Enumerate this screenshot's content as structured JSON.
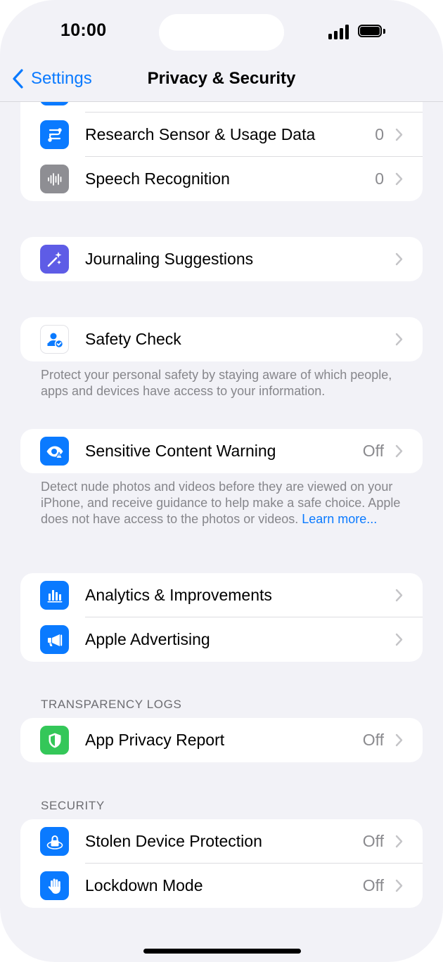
{
  "status_bar": {
    "time": "10:00"
  },
  "nav": {
    "back_label": "Settings",
    "title": "Privacy & Security"
  },
  "group_top": {
    "rows": [
      {
        "label": "Research Sensor & Usage Data",
        "value": "0",
        "icon": "research-sensor-icon",
        "color": "#0a7aff"
      },
      {
        "label": "Speech Recognition",
        "value": "0",
        "icon": "waveform-icon",
        "color": "#8e8e93"
      }
    ]
  },
  "journaling": {
    "label": "Journaling Suggestions",
    "icon": "sparkles-icon",
    "color": "#5e5ce6"
  },
  "safety_check": {
    "label": "Safety Check",
    "icon": "person-check-icon",
    "footnote": "Protect your personal safety by staying aware of which people, apps and devices have access to your information."
  },
  "sensitive": {
    "label": "Sensitive Content Warning",
    "value": "Off",
    "icon": "eye-warning-icon",
    "color": "#0a7aff",
    "footnote": "Detect nude photos and videos before they are viewed on your iPhone, and receive guidance to help make a safe choice. Apple does not have access to the photos or videos.",
    "learn_more": "Learn more..."
  },
  "analytics_group": {
    "rows": [
      {
        "label": "Analytics & Improvements",
        "icon": "bar-chart-icon",
        "color": "#0a7aff"
      },
      {
        "label": "Apple Advertising",
        "icon": "megaphone-icon",
        "color": "#0a7aff"
      }
    ]
  },
  "transparency": {
    "header": "TRANSPARENCY LOGS",
    "label": "App Privacy Report",
    "value": "Off",
    "icon": "shield-icon",
    "color": "#34c759"
  },
  "security": {
    "header": "SECURITY",
    "rows": [
      {
        "label": "Stolen Device Protection",
        "value": "Off",
        "icon": "lock-icon",
        "color": "#0a7aff"
      },
      {
        "label": "Lockdown Mode",
        "value": "Off",
        "icon": "hand-icon",
        "color": "#0a7aff"
      }
    ]
  }
}
